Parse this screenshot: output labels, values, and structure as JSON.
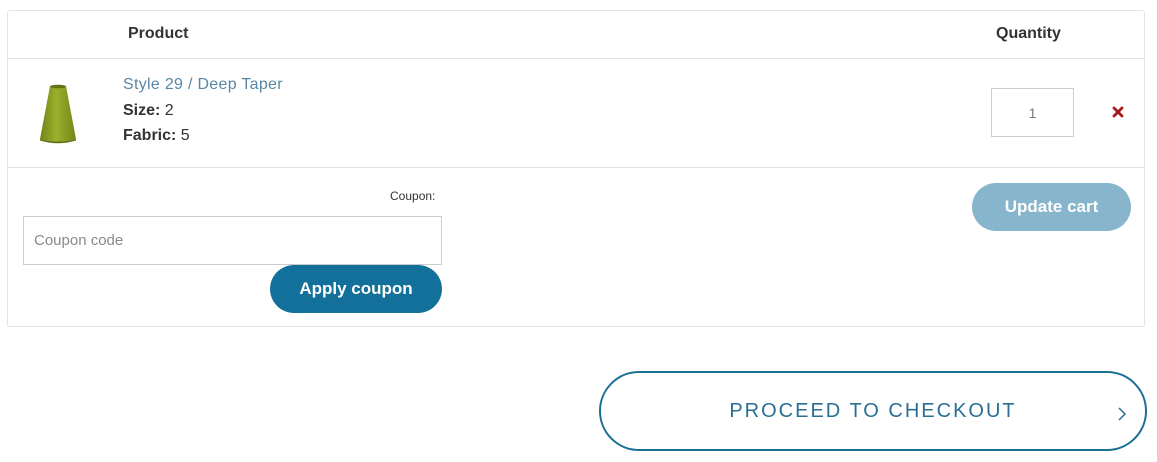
{
  "table": {
    "header": {
      "product": "Product",
      "quantity": "Quantity"
    },
    "items": [
      {
        "name": "Style 29 / Deep Taper",
        "size_label": "Size:",
        "size_value": "2",
        "fabric_label": "Fabric:",
        "fabric_value": "5",
        "quantity": "1",
        "thumbnail": "green-lampshade",
        "remove_icon": "close-icon"
      }
    ]
  },
  "coupon": {
    "label": "Coupon:",
    "placeholder": "Coupon code",
    "apply_label": "Apply coupon"
  },
  "update_cart_label": "Update cart",
  "checkout": {
    "label": "PROCEED TO CHECKOUT",
    "icon": "chevron-right-icon"
  },
  "colors": {
    "primary": "#12709a",
    "disabled_button": "#86b5cc",
    "link": "#5a86a3",
    "remove": "#a61b1b",
    "lampshade": "#8ea326"
  }
}
